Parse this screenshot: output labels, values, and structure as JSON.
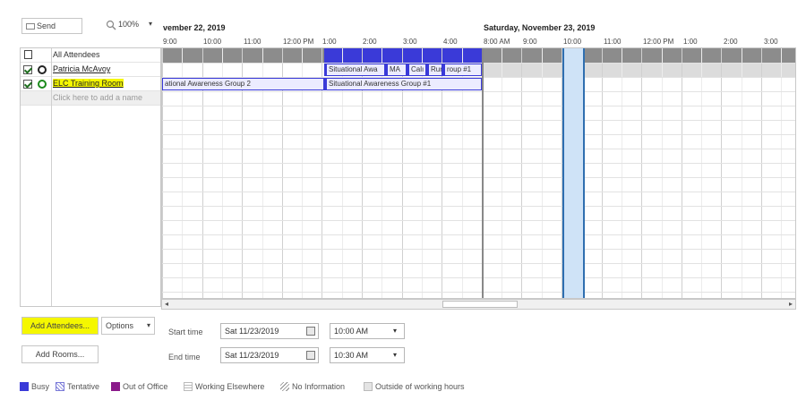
{
  "toolbar": {
    "send_label": "Send",
    "zoom_value": "100%"
  },
  "schedule": {
    "day1_header": "vember 22, 2019",
    "day2_header": "Saturday, November 23, 2019",
    "day1_times": [
      "9:00",
      "10:00",
      "11:00",
      "12:00 PM",
      "1:00",
      "2:00",
      "3:00",
      "4:00"
    ],
    "day2_times": [
      "8:00 AM",
      "9:00",
      "10:00",
      "11:00",
      "12:00 PM",
      "1:00",
      "2:00",
      "3:00"
    ]
  },
  "attendees": {
    "header_label": "All Attendees",
    "list": [
      {
        "name": "Patricia McAvoy",
        "checked": true
      },
      {
        "name": "ELC Training Room",
        "checked": true
      }
    ],
    "add_name_placeholder": "Click here to add a name"
  },
  "appointments": {
    "patricia": [
      "Situational Awa",
      "MA",
      "Calı",
      "Run",
      "roup #1"
    ],
    "room": [
      "ational Awareness Group 2",
      "Situational Awareness Group #1"
    ]
  },
  "buttons": {
    "add_attendees": "Add Attendees...",
    "options": "Options",
    "add_rooms": "Add Rooms..."
  },
  "meeting": {
    "start_label": "Start time",
    "start_date": "Sat 11/23/2019",
    "start_time": "10:00 AM",
    "end_label": "End time",
    "end_date": "Sat 11/23/2019",
    "end_time": "10:30 AM"
  },
  "legend": {
    "busy": "Busy",
    "tentative": "Tentative",
    "out_of_office": "Out of Office",
    "working_elsewhere": "Working Elsewhere",
    "no_information": "No Information",
    "outside_hours": "Outside of working hours"
  },
  "colors": {
    "busy": "#3a3ad8",
    "out_of_office": "#8a1a8a",
    "highlight": "#f5f700",
    "selection": "#cfe3f7",
    "selection_border": "#2f6fb0"
  }
}
